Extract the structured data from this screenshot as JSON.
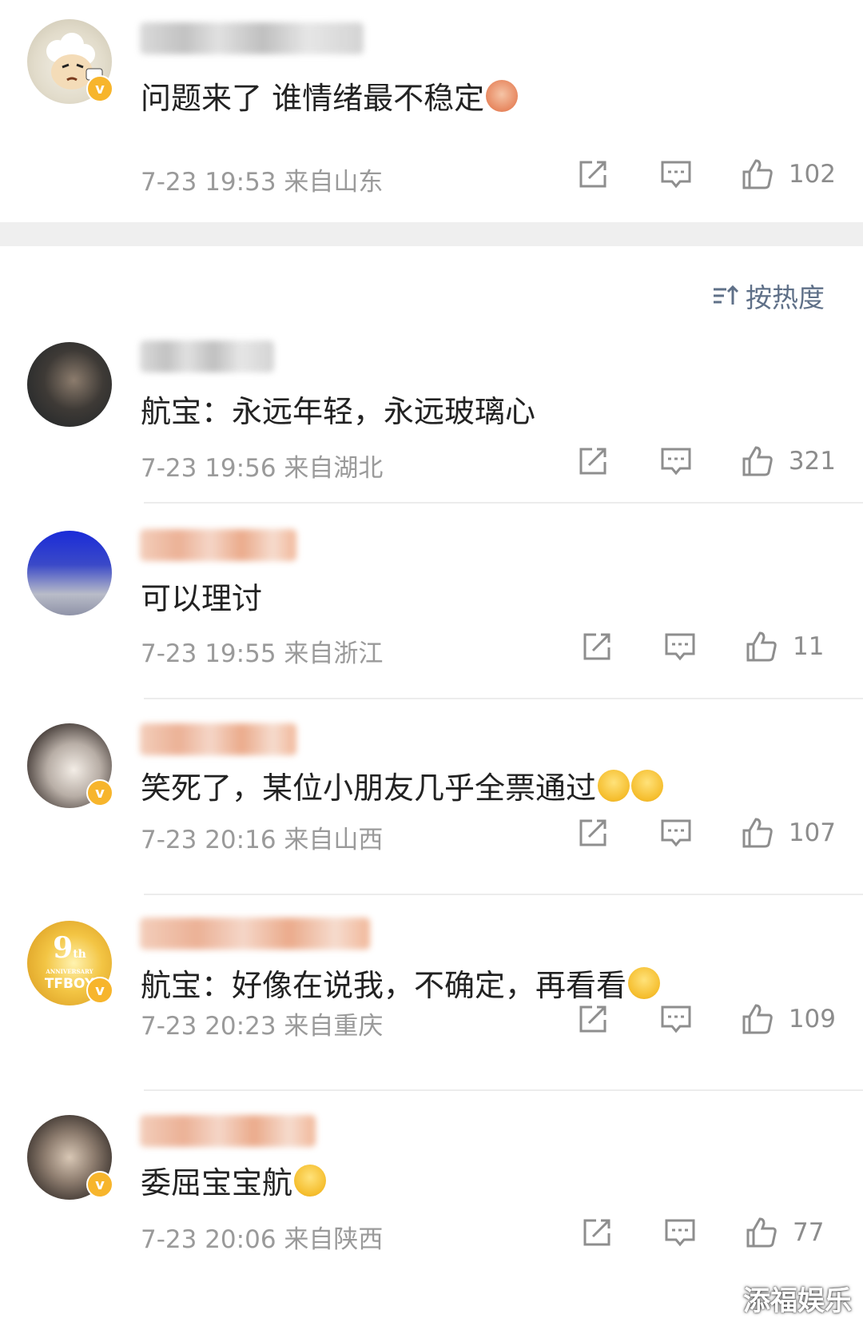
{
  "post": {
    "text": "问题来了 谁情绪最不稳定",
    "emoji": "fan-emoji",
    "time": "7-23 19:53",
    "location": "来自山东",
    "likes": "102"
  },
  "sort": {
    "label": "按热度",
    "icon": "sort-icon"
  },
  "comments": [
    {
      "text": "航宝：永远年轻，永远玻璃心",
      "time": "7-23 19:56",
      "location": "来自湖北",
      "likes": "321",
      "verified": false,
      "emojis": []
    },
    {
      "text": "可以理讨",
      "time": "7-23 19:55",
      "location": "来自浙江",
      "likes": "11",
      "verified": false,
      "emojis": []
    },
    {
      "text": "笑死了，某位小朋友几乎全票通过",
      "time": "7-23 20:16",
      "location": "来自山西",
      "likes": "107",
      "verified": true,
      "emojis": [
        "laugh-cry-emoji",
        "laugh-cry-emoji"
      ]
    },
    {
      "text": "航宝：好像在说我，不确定，再看看",
      "time": "7-23 20:23",
      "location": "来自重庆",
      "likes": "109",
      "verified": true,
      "emojis": [
        "worried-emoji"
      ],
      "avatar_text": {
        "num": "9",
        "sup": "th",
        "sub": "ANNIVERSARY",
        "brand": "TFBOY"
      }
    },
    {
      "text": "委屈宝宝航",
      "time": "7-23 20:06",
      "location": "来自陕西",
      "likes": "77",
      "verified": true,
      "emojis": [
        "pleading-emoji"
      ]
    }
  ],
  "watermark": "添福娱乐",
  "colors": {
    "meta": "#9a9a9a",
    "sort": "#5f7088",
    "badge": "#f7b52c",
    "divider": "#ececec"
  }
}
